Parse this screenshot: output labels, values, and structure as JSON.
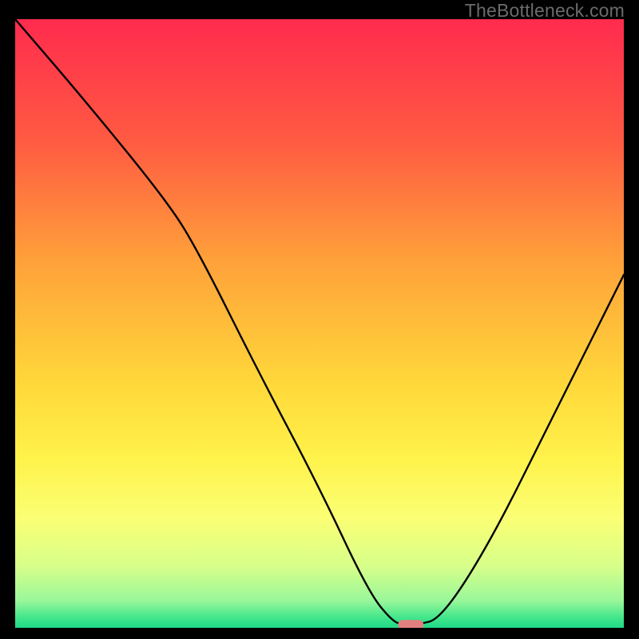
{
  "watermark": "TheBottleneck.com",
  "chart_data": {
    "type": "line",
    "title": "",
    "xlabel": "",
    "ylabel": "",
    "xlim": [
      0,
      100
    ],
    "ylim": [
      0,
      100
    ],
    "series": [
      {
        "name": "curve",
        "x": [
          0,
          12,
          25,
          30,
          40,
          50,
          58,
          62,
          64,
          66,
          70,
          78,
          88,
          100
        ],
        "y": [
          100,
          86,
          70,
          62,
          42,
          23,
          6,
          1,
          0.5,
          0.5,
          1.5,
          14,
          34,
          58
        ]
      }
    ],
    "marker": {
      "name": "optimal-point",
      "x": 65,
      "y": 0.5,
      "color": "#e2807f",
      "width": 4.2,
      "height": 1.6
    },
    "background": {
      "type": "vertical-gradient",
      "stops": [
        {
          "pos": 0.0,
          "color": "#ff2b4e"
        },
        {
          "pos": 0.2,
          "color": "#ff5a42"
        },
        {
          "pos": 0.4,
          "color": "#ffa23a"
        },
        {
          "pos": 0.6,
          "color": "#ffd83a"
        },
        {
          "pos": 0.72,
          "color": "#fff24a"
        },
        {
          "pos": 0.82,
          "color": "#fbff74"
        },
        {
          "pos": 0.9,
          "color": "#d6ff8a"
        },
        {
          "pos": 0.955,
          "color": "#99f79a"
        },
        {
          "pos": 0.985,
          "color": "#3de58a"
        },
        {
          "pos": 1.0,
          "color": "#1fd887"
        }
      ]
    }
  }
}
